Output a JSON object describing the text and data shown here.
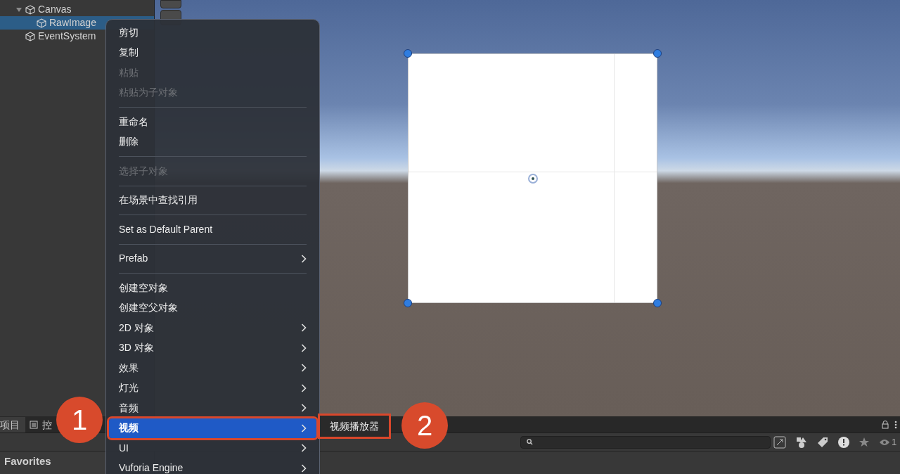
{
  "hierarchy": {
    "items": [
      {
        "label": "Canvas",
        "expanded": true,
        "selected": false,
        "children": [
          {
            "label": "RawImage",
            "selected": true
          }
        ]
      },
      {
        "label": "EventSystem",
        "selected": false
      }
    ]
  },
  "context_menu": {
    "items": [
      {
        "kind": "item",
        "label": "剪切",
        "disabled": false,
        "submenu": false,
        "selected": false
      },
      {
        "kind": "item",
        "label": "复制",
        "disabled": false,
        "submenu": false,
        "selected": false
      },
      {
        "kind": "item",
        "label": "粘贴",
        "disabled": true,
        "submenu": false,
        "selected": false
      },
      {
        "kind": "item",
        "label": "粘贴为子对象",
        "disabled": true,
        "submenu": false,
        "selected": false
      },
      {
        "kind": "separator"
      },
      {
        "kind": "item",
        "label": "重命名",
        "disabled": false,
        "submenu": false,
        "selected": false
      },
      {
        "kind": "item",
        "label": "删除",
        "disabled": false,
        "submenu": false,
        "selected": false
      },
      {
        "kind": "separator"
      },
      {
        "kind": "item",
        "label": "选择子对象",
        "disabled": true,
        "submenu": false,
        "selected": false
      },
      {
        "kind": "separator"
      },
      {
        "kind": "item",
        "label": "在场景中查找引用",
        "disabled": false,
        "submenu": false,
        "selected": false
      },
      {
        "kind": "separator"
      },
      {
        "kind": "item",
        "label": "Set as Default Parent",
        "disabled": false,
        "submenu": false,
        "selected": false
      },
      {
        "kind": "separator"
      },
      {
        "kind": "item",
        "label": "Prefab",
        "disabled": false,
        "submenu": true,
        "selected": false
      },
      {
        "kind": "separator"
      },
      {
        "kind": "item",
        "label": "创建空对象",
        "disabled": false,
        "submenu": false,
        "selected": false
      },
      {
        "kind": "item",
        "label": "创建空父对象",
        "disabled": false,
        "submenu": false,
        "selected": false
      },
      {
        "kind": "item",
        "label": "2D 对象",
        "disabled": false,
        "submenu": true,
        "selected": false
      },
      {
        "kind": "item",
        "label": "3D 对象",
        "disabled": false,
        "submenu": true,
        "selected": false
      },
      {
        "kind": "item",
        "label": "效果",
        "disabled": false,
        "submenu": true,
        "selected": false
      },
      {
        "kind": "item",
        "label": "灯光",
        "disabled": false,
        "submenu": true,
        "selected": false
      },
      {
        "kind": "item",
        "label": "音频",
        "disabled": false,
        "submenu": true,
        "selected": false
      },
      {
        "kind": "item",
        "label": "视频",
        "disabled": false,
        "submenu": true,
        "selected": true
      },
      {
        "kind": "item",
        "label": "UI",
        "disabled": false,
        "submenu": true,
        "selected": false
      },
      {
        "kind": "item",
        "label": "Vuforia Engine",
        "disabled": false,
        "submenu": true,
        "selected": false
      }
    ]
  },
  "submenu": {
    "items": [
      {
        "label": "视频播放器"
      }
    ]
  },
  "bottom_panel": {
    "tabs": [
      {
        "label": "项目",
        "selected": true
      },
      {
        "label": "控",
        "selected": false
      }
    ],
    "favorites": "Favorites",
    "count": "1"
  },
  "annotations": [
    {
      "label": "1"
    },
    {
      "label": "2"
    }
  ]
}
